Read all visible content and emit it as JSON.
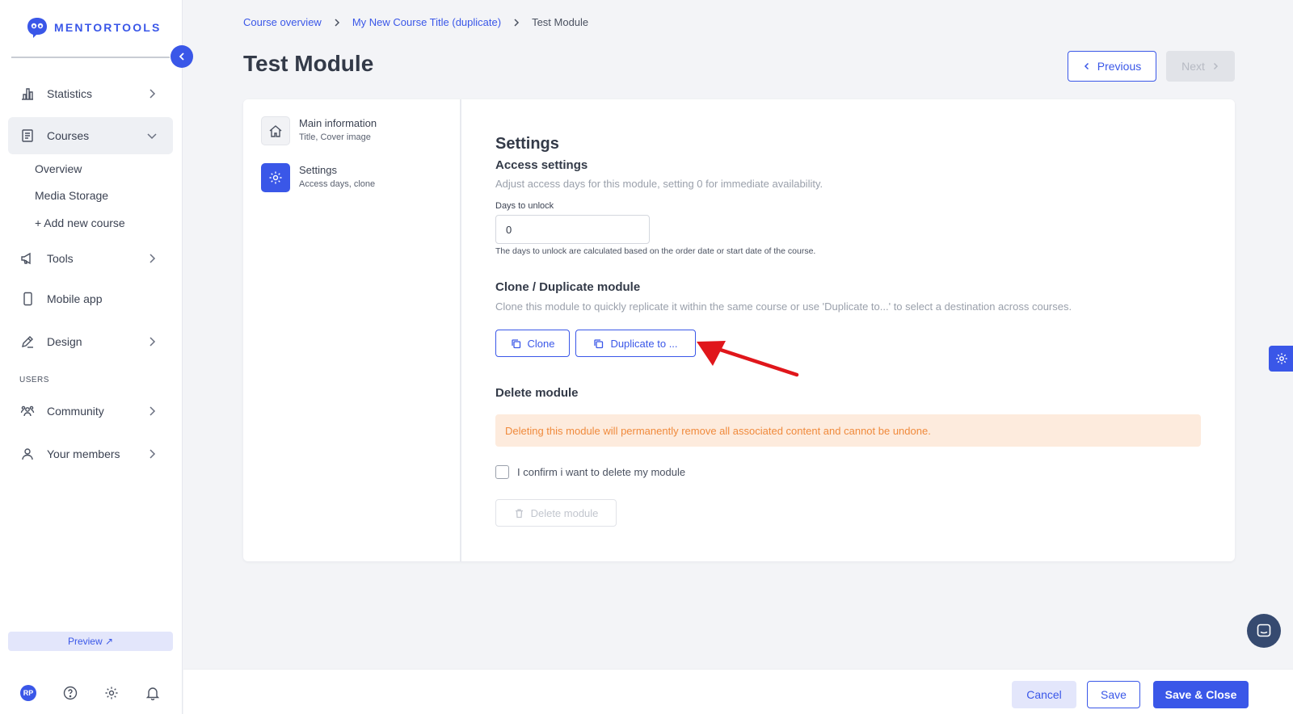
{
  "brand": {
    "name": "MENTORTOOLS",
    "color": "#3a57e8"
  },
  "sidebar": {
    "items": [
      {
        "label": "Statistics",
        "icon": "bar-chart-icon"
      },
      {
        "label": "Courses",
        "icon": "book-icon"
      },
      {
        "label": "Tools",
        "icon": "megaphone-icon"
      },
      {
        "label": "Mobile app",
        "icon": "phone-icon"
      },
      {
        "label": "Design",
        "icon": "pencil-icon"
      },
      {
        "label": "Community",
        "icon": "people-icon"
      },
      {
        "label": "Your members",
        "icon": "user-icon"
      }
    ],
    "course_subitems": [
      "Overview",
      "Media Storage",
      "+ Add new course"
    ],
    "section_users": "USERS",
    "preview_label": "Preview ↗",
    "avatar_initials": "RP"
  },
  "breadcrumb": {
    "items": [
      "Course overview",
      "My New Course Title (duplicate)"
    ],
    "current": "Test Module"
  },
  "page": {
    "title": "Test Module",
    "prev_label": "Previous",
    "next_label": "Next"
  },
  "steps": [
    {
      "title": "Main information",
      "subtitle": "Title, Cover image",
      "icon": "home-icon"
    },
    {
      "title": "Settings",
      "subtitle": "Access days, clone",
      "icon": "gear-icon"
    }
  ],
  "settings": {
    "heading": "Settings",
    "access": {
      "heading": "Access settings",
      "description": "Adjust access days for this module, setting 0 for immediate availability.",
      "field_label": "Days to unlock",
      "field_value": "0",
      "hint": "The days to unlock are calculated based on the order date or start date of the course."
    },
    "clone": {
      "heading": "Clone / Duplicate module",
      "description": "Clone this module to quickly replicate it within the same course or use 'Duplicate to...' to select a destination across courses.",
      "clone_label": "Clone",
      "duplicate_label": "Duplicate to ..."
    },
    "delete": {
      "heading": "Delete module",
      "warning": "Deleting this module will permanently remove all associated content and cannot be undone.",
      "confirm_label": "I confirm i want to delete my module",
      "confirmed": false,
      "button_label": "Delete module"
    }
  },
  "footer": {
    "cancel_label": "Cancel",
    "save_label": "Save",
    "save_close_label": "Save & Close"
  },
  "colors": {
    "accent": "#3a57e8",
    "warning_bg": "#fdebdd",
    "warning_text": "#f08a3c",
    "annotation_arrow": "#e0161b"
  }
}
